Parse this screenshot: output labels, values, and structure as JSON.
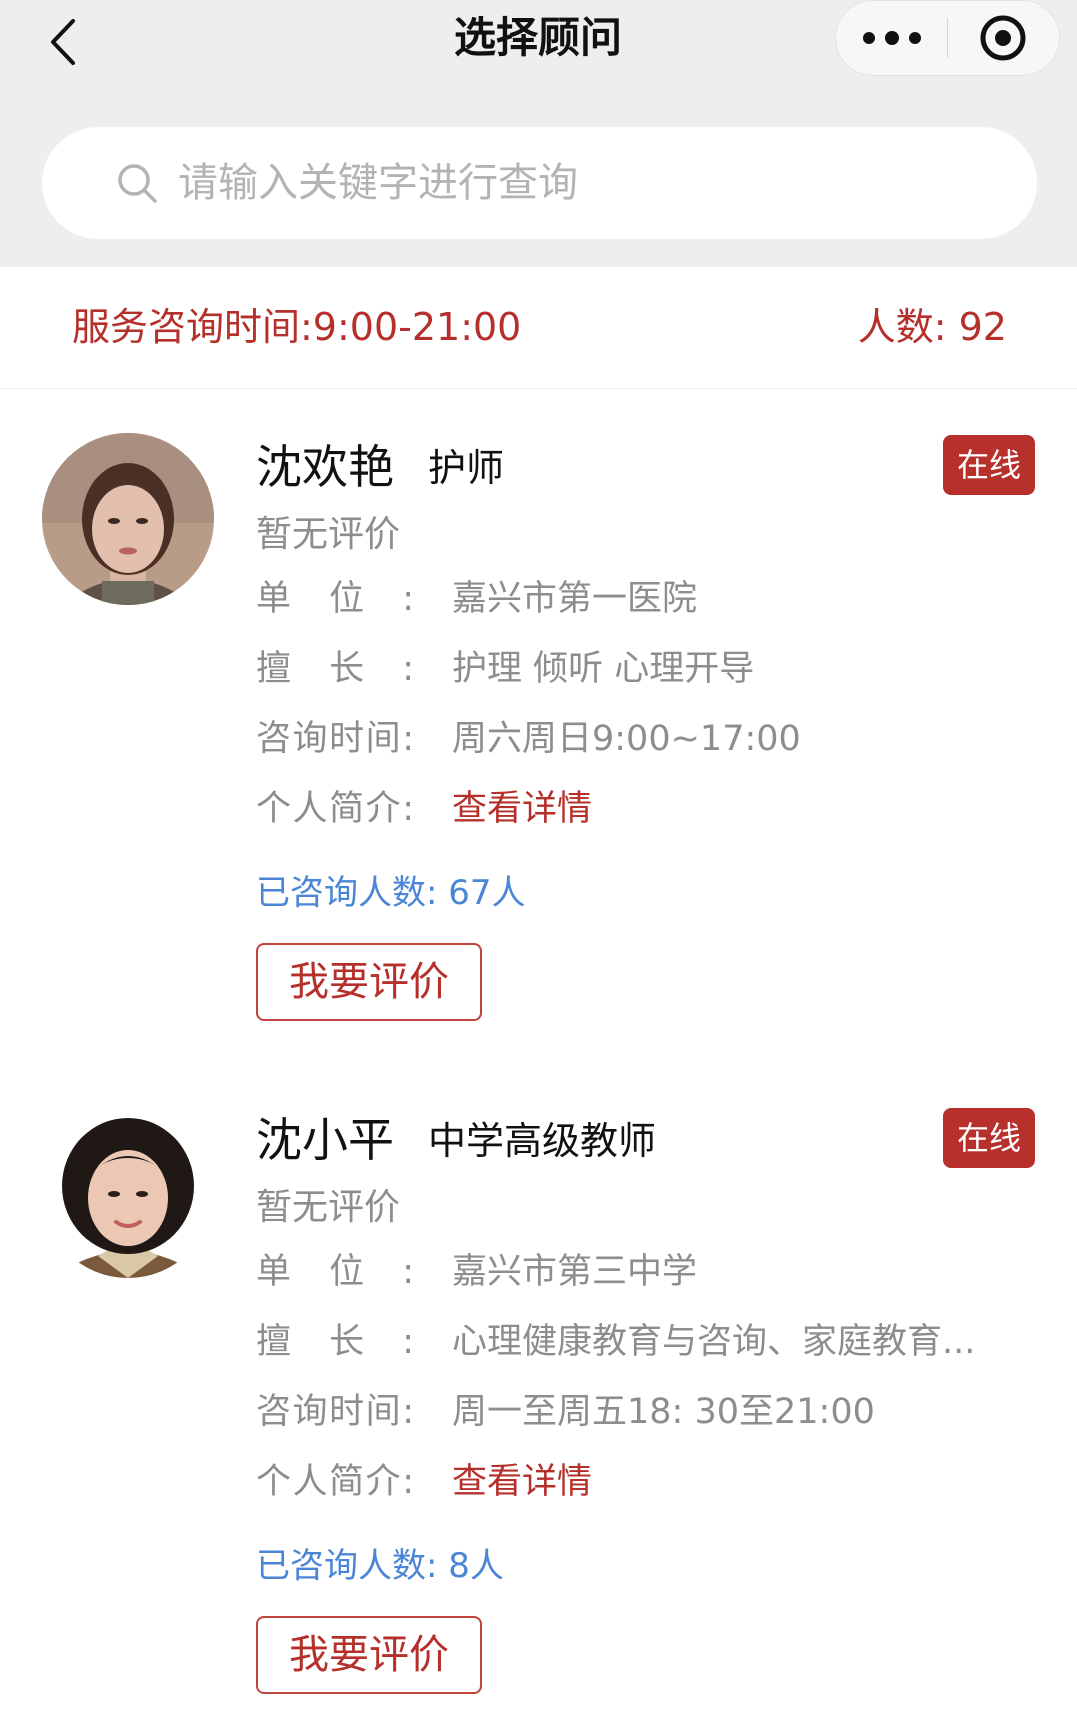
{
  "nav": {
    "title": "选择顾问",
    "back_icon": "chevron-left-icon",
    "more_icon": "more-dots-icon",
    "close_icon": "target-circle-icon"
  },
  "search": {
    "placeholder": "请输入关键字进行查询",
    "icon": "search-icon"
  },
  "info": {
    "service_time": "服务咨询时间:9:00-21:00",
    "count_label": "人数: 92"
  },
  "colors": {
    "accent_red": "#b5302b",
    "link_blue": "#4b86d6",
    "muted_gray": "#8d8d8d",
    "page_gray": "#eeeeee"
  },
  "labels": {
    "unit": "单位:",
    "specialty": "擅长:",
    "consult_time": "咨询时间:",
    "intro": "个人简介:"
  },
  "advisors": [
    {
      "name": "沈欢艳",
      "title": "护师",
      "status": "在线",
      "rating": "暂无评价",
      "unit": "嘉兴市第一医院",
      "specialty": "护理 倾听 心理开导",
      "consult_time": "周六周日9:00~17:00",
      "intro_link": "查看详情",
      "consulted": "已咨询人数: 67人",
      "review_button": "我要评价"
    },
    {
      "name": "沈小平",
      "title": "中学高级教师",
      "status": "在线",
      "rating": "暂无评价",
      "unit": "嘉兴市第三中学",
      "specialty": "心理健康教育与咨询、家庭教育...",
      "consult_time": "周一至周五18: 30至21:00",
      "intro_link": "查看详情",
      "consulted": "已咨询人数: 8人",
      "review_button": "我要评价"
    }
  ]
}
